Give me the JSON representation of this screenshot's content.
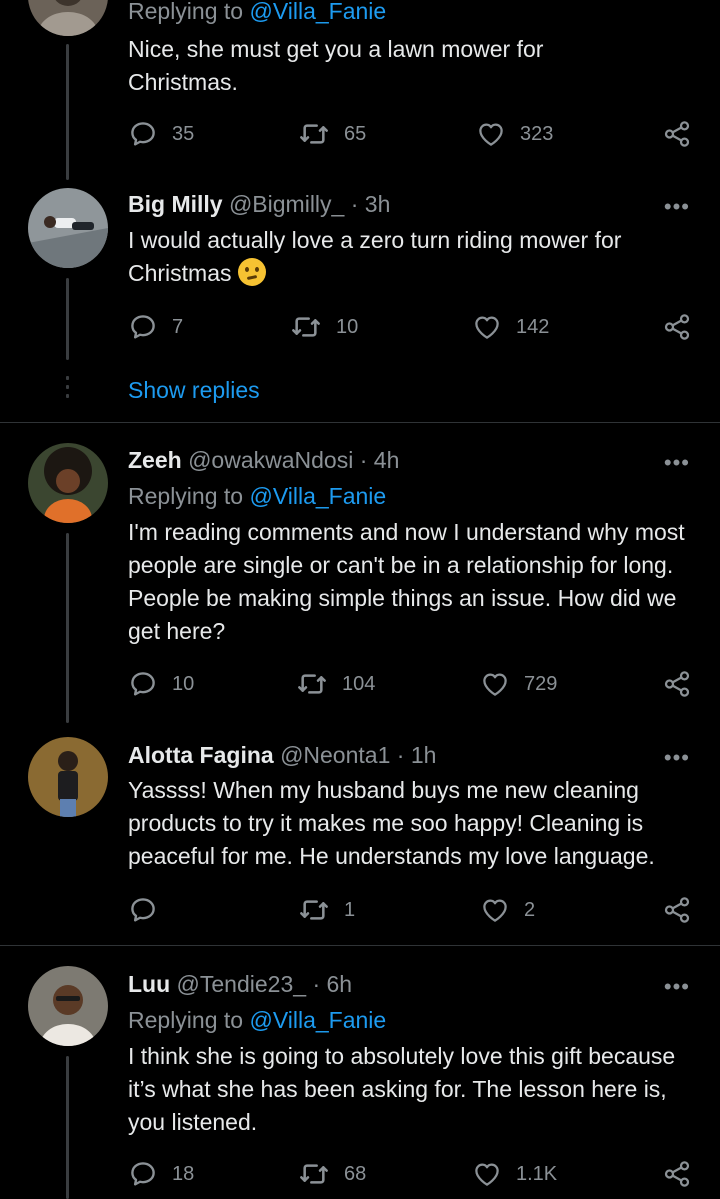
{
  "colors": {
    "background": "#000000",
    "text": "#e7e9ea",
    "muted": "#8b9196",
    "accent": "#1d9bf0",
    "divider": "#2f3336"
  },
  "top_partial": {
    "reply_to_prefix": "Replying to",
    "reply_to_handle": "@Villa_Fanie",
    "text": "Nice, she must get you a lawn mower for Christmas.",
    "replies": "35",
    "retweets": "65",
    "likes": "323"
  },
  "tweets": [
    {
      "name": "Big Milly",
      "handle": "@Bigmilly_",
      "dot": "·",
      "time": "3h",
      "text": "I would actually love a zero turn riding mower for Christmas",
      "emoji": "thinking-face-emoji",
      "replies": "7",
      "retweets": "10",
      "likes": "142"
    },
    {
      "name": "Zeeh",
      "handle": "@owakwaNdosi",
      "dot": "·",
      "time": "4h",
      "reply_to_prefix": "Replying to",
      "reply_to_handle": "@Villa_Fanie",
      "text": "I'm reading comments and now I understand why most people are single or can't be in a relationship for long. People be making simple things an issue. How did we get here?",
      "replies": "10",
      "retweets": "104",
      "likes": "729"
    },
    {
      "name": "Alotta Fagina",
      "handle": "@Neonta1",
      "dot": "·",
      "time": "1h",
      "text": "Yassss! When my husband buys me new cleaning products to try it makes me soo happy! Cleaning is peaceful for me. He understands my love language.",
      "replies": "",
      "retweets": "1",
      "likes": "2"
    },
    {
      "name": "Luu",
      "handle": "@Tendie23_",
      "dot": "·",
      "time": "6h",
      "reply_to_prefix": "Replying to",
      "reply_to_handle": "@Villa_Fanie",
      "text": "I think she is going to absolutely love this gift because it’s what she has been asking for. The lesson here is, you listened.",
      "replies": "18",
      "retweets": "68",
      "likes": "1.1K"
    }
  ],
  "show_replies_label": "Show replies",
  "more_glyph": "•••"
}
